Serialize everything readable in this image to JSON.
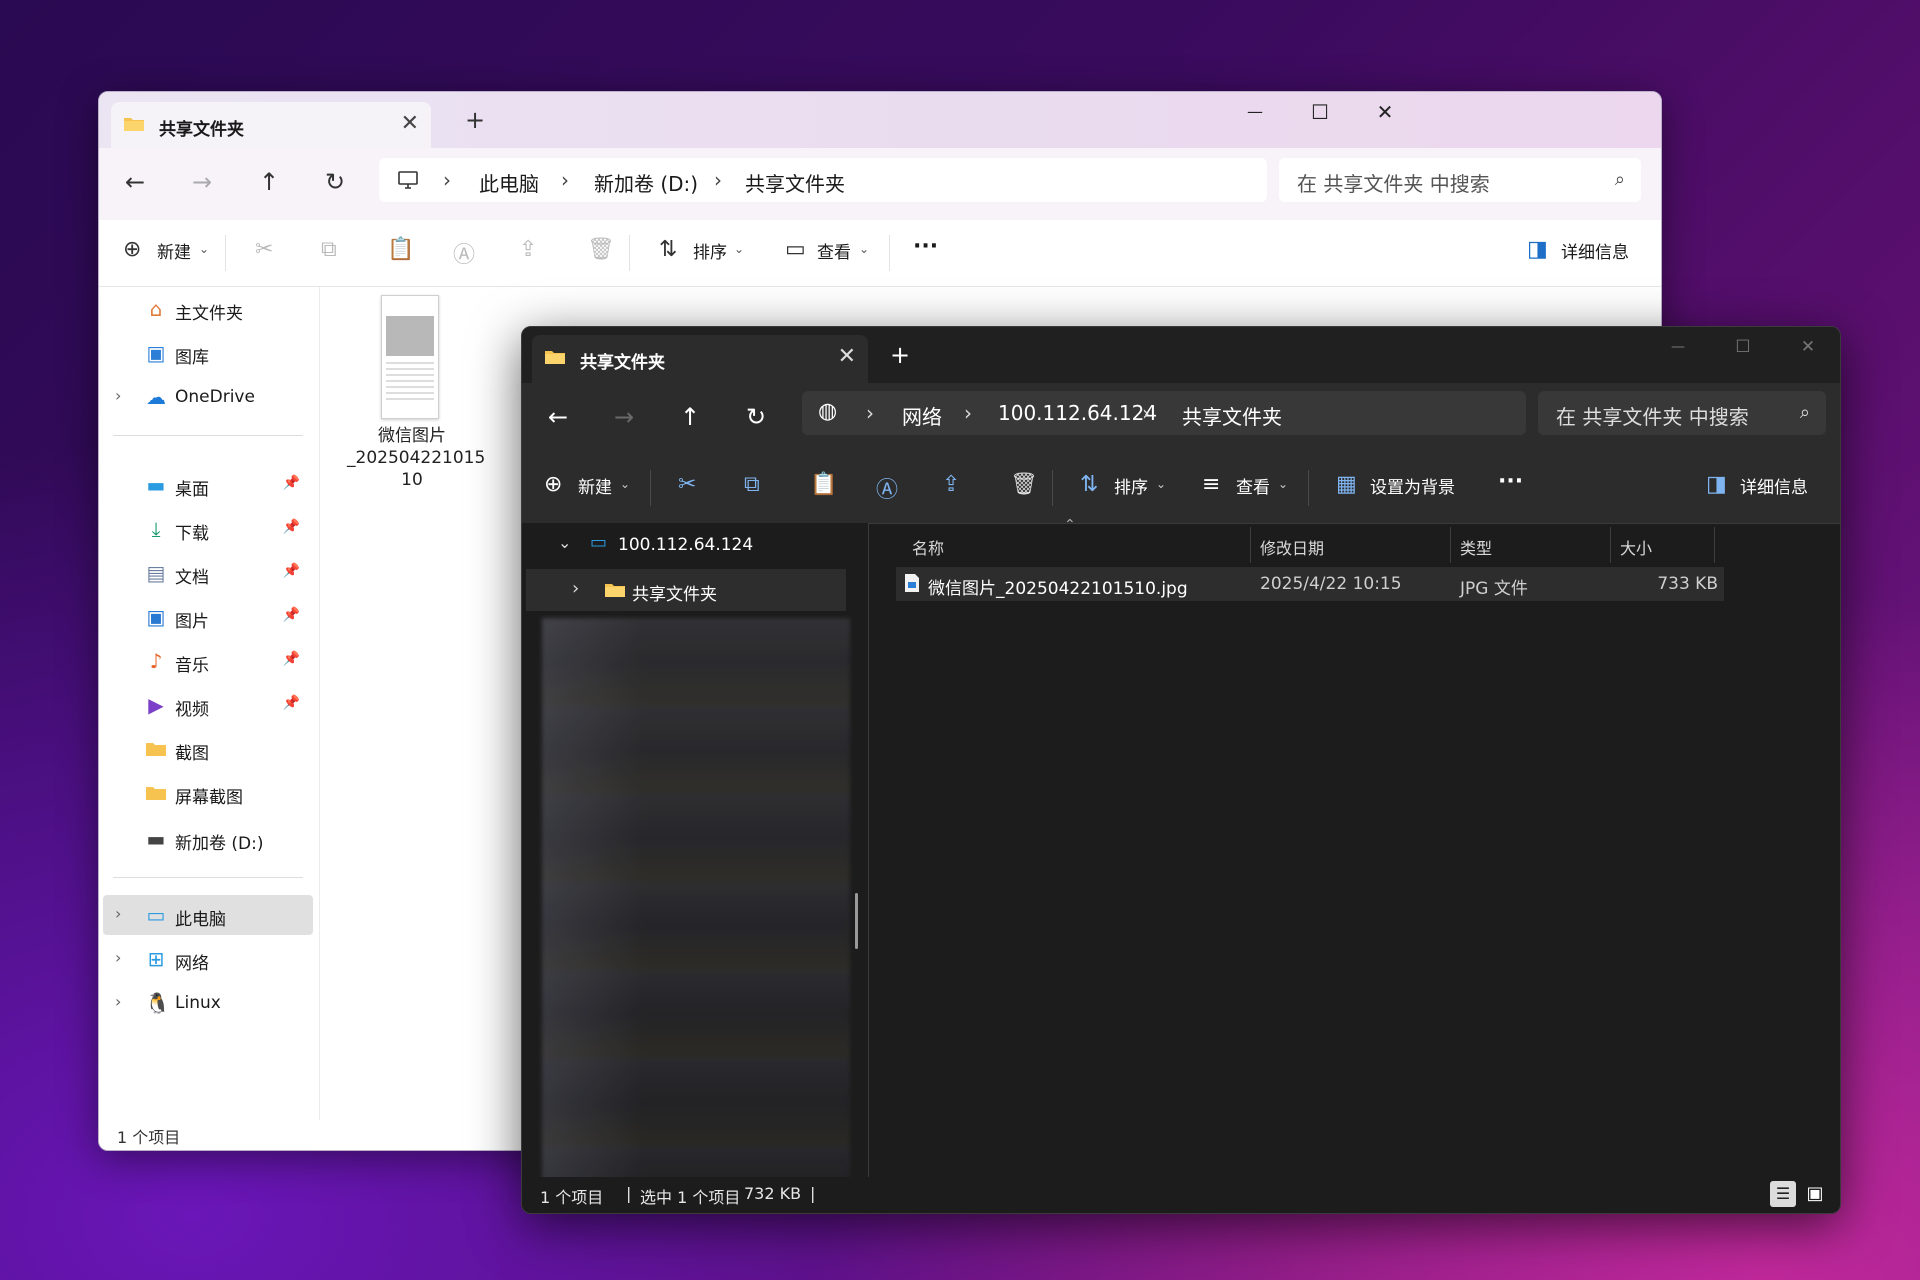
{
  "colors": {
    "light_bg": "#ffffff",
    "dark_bg": "#1c1c1c",
    "folder": "#f6c350",
    "accent": "#4aa3e8"
  },
  "light_window": {
    "tab_title": "共享文件夹",
    "new_tab": "+",
    "window_controls": {
      "minimize": "—",
      "maximize": "☐",
      "close": "✕"
    },
    "breadcrumb": [
      "此电脑",
      "新加卷 (D:)",
      "共享文件夹"
    ],
    "search_placeholder": "在 共享文件夹 中搜索",
    "toolbar": {
      "new": "新建",
      "sort": "排序",
      "view": "查看",
      "more": "···",
      "details": "详细信息"
    },
    "sidebar": [
      {
        "label": "主文件夹",
        "icon": "home-icon"
      },
      {
        "label": "图库",
        "icon": "gallery-icon"
      },
      {
        "label": "OneDrive",
        "icon": "onedrive-icon"
      },
      {
        "label": "桌面",
        "icon": "desktop-icon"
      },
      {
        "label": "下载",
        "icon": "download-icon"
      },
      {
        "label": "文档",
        "icon": "document-icon"
      },
      {
        "label": "图片",
        "icon": "pictures-icon"
      },
      {
        "label": "音乐",
        "icon": "music-icon"
      },
      {
        "label": "视频",
        "icon": "video-icon"
      },
      {
        "label": "截图",
        "icon": "folder-icon"
      },
      {
        "label": "屏幕截图",
        "icon": "folder-icon"
      },
      {
        "label": "新加卷 (D:)",
        "icon": "drive-icon"
      },
      {
        "label": "此电脑",
        "icon": "pc-icon"
      },
      {
        "label": "网络",
        "icon": "network-icon"
      },
      {
        "label": "Linux",
        "icon": "linux-icon"
      }
    ],
    "file": {
      "name_line1": "微信图片",
      "name_line2": "_202504221015",
      "name_line3": "10"
    },
    "status": "1 个项目"
  },
  "dark_window": {
    "tab_title": "共享文件夹",
    "new_tab": "+",
    "window_controls": {
      "minimize": "—",
      "maximize": "☐",
      "close": "✕"
    },
    "breadcrumb": [
      "网络",
      "100.112.64.124",
      "共享文件夹"
    ],
    "search_placeholder": "在 共享文件夹 中搜索",
    "toolbar": {
      "new": "新建",
      "sort": "排序",
      "view": "查看",
      "set_background": "设置为背景",
      "more": "···",
      "details": "详细信息"
    },
    "tree": {
      "host": "100.112.64.124",
      "folder": "共享文件夹"
    },
    "columns": {
      "name": "名称",
      "modified": "修改日期",
      "type": "类型",
      "size": "大小"
    },
    "files": [
      {
        "name": "微信图片_20250422101510.jpg",
        "modified": "2025/4/22 10:15",
        "type": "JPG 文件",
        "size": "733 KB"
      }
    ],
    "status": {
      "count": "1 个项目",
      "selected": "选中 1 个项目",
      "selected_size": "732 KB"
    }
  }
}
